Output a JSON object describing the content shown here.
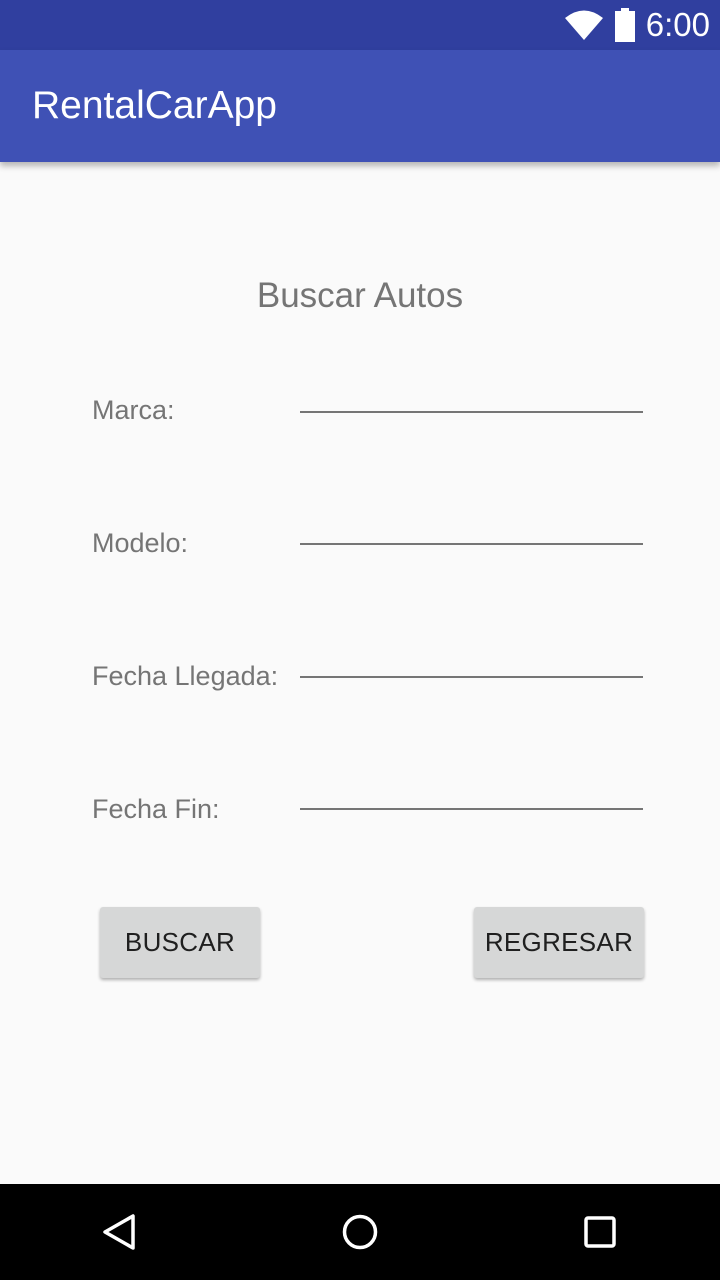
{
  "status_bar": {
    "time": "6:00",
    "icons": [
      "wifi-icon",
      "battery-icon"
    ]
  },
  "app_bar": {
    "title": "RentalCarApp"
  },
  "form": {
    "heading": "Buscar Autos",
    "fields": [
      {
        "label": "Marca:",
        "value": ""
      },
      {
        "label": "Modelo:",
        "value": ""
      },
      {
        "label": "Fecha Llegada:",
        "value": ""
      },
      {
        "label": "Fecha Fin:",
        "value": ""
      }
    ],
    "buttons": {
      "search_label": "BUSCAR",
      "back_label": "REGRESAR"
    }
  },
  "nav_bar": {
    "icons": [
      "back-triangle-icon",
      "home-circle-icon",
      "recents-square-icon"
    ]
  },
  "colors": {
    "status_bar": "#303f9f",
    "app_bar": "#3f51b5",
    "background": "#fafafa",
    "button": "#d6d7d7",
    "label_text": "#757575"
  }
}
